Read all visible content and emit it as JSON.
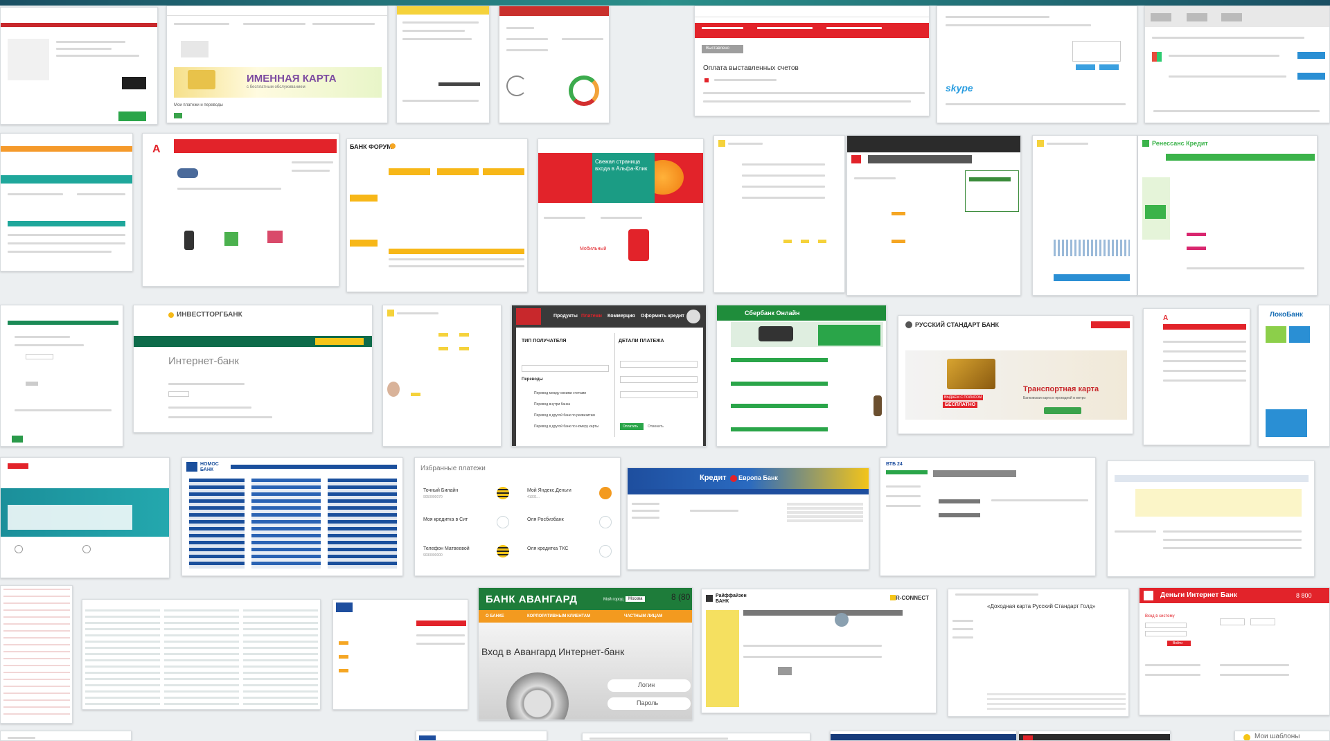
{
  "thumbnails": {
    "t02": {
      "banner": "ИМЕННАЯ КАРТА",
      "banner_sub": "с бесплатным обслуживанием",
      "footer": "Мои платежи и переводы"
    },
    "t05": {
      "title": "Оплата выставленных счетов",
      "tab": "Выставлено"
    },
    "t06": {
      "logo": "skype"
    },
    "t10": {
      "logo": "БАНК ФОРУМ"
    },
    "t11": {
      "promo": "Свежая страница входа в Альфа-Клик",
      "logo2": "Мобильный"
    },
    "t15": {
      "logo": "Ренессанс Кредит"
    },
    "t17": {
      "logo": "ИНВЕСТТОРГБАНК",
      "title": "Интернет-банк"
    },
    "t19": {
      "nav": [
        "Продукты",
        "Платежи",
        "Коммерция",
        "Оформить кредит"
      ],
      "col1": "ТИП ПОЛУЧАТЕЛЯ",
      "col2": "ДЕТАЛИ ПЛАТЕЖА",
      "section": "Переводы",
      "items": [
        "Перевод между своими счетами",
        "Перевод внутри банка",
        "Перевод в другой банк по реквизитам",
        "Перевод в другой банк по номеру карты"
      ],
      "confirm": "Оплатить",
      "cancel": "Отменить"
    },
    "t20": {
      "logo": "Сбербанк Онлайн"
    },
    "t21": {
      "logo": "РУССКИЙ СТАНДАРТ БАНК",
      "promo": "Транспортная карта",
      "promo_sub": "Банковская карта и проездной в метро",
      "badge": "БЕСПЛАТНО",
      "badge_pre": "ВЫДАЁМ С ПОЛИСОМ"
    },
    "t23": {
      "logo": "ЛокоБанк"
    },
    "t25": {
      "logo": "НОМОС БАНК"
    },
    "t26": {
      "title": "Избранные платежи",
      "items": [
        {
          "name": "Точный Билайн",
          "sub": "9050000070"
        },
        {
          "name": "Мой Яндекс.Деньги",
          "sub": "41001..."
        },
        {
          "name": "Моя кредитка в Сит",
          "sub": ""
        },
        {
          "name": "Оля Росбизбанк",
          "sub": ""
        },
        {
          "name": "Телефон Матвеевой",
          "sub": "9030000000"
        },
        {
          "name": "Оля кредитка ТКС",
          "sub": ""
        }
      ]
    },
    "t27": {
      "logo": "Кредит",
      "logo2": "Европа Банк"
    },
    "t28": {
      "logo": "ВТБ 24"
    },
    "t33": {
      "logo": "БАНК АВАНГАРД",
      "phone": "8 (80",
      "nav": [
        "О БАНКЕ",
        "КОРПОРАТИВНЫМ КЛИЕНТАМ",
        "ЧАСТНЫМ ЛИЦАМ"
      ],
      "city_label": "Мой город",
      "city": "Москва",
      "title": "Вход в Авангард Интернет-банк",
      "login": "Логин",
      "password": "Пароль"
    },
    "t34": {
      "logo": "Райффайзен БАНК",
      "logo2": "R-CONNECT"
    },
    "t35": {
      "title": "«Доходная карта Русский Стандарт Голд»"
    },
    "t36": {
      "logo": "Деньги Интернет Банк",
      "phone": "8 800",
      "login_title": "Вход в систему",
      "btn": "Войти"
    },
    "b09": {
      "text": "Мои шаблоны"
    }
  }
}
